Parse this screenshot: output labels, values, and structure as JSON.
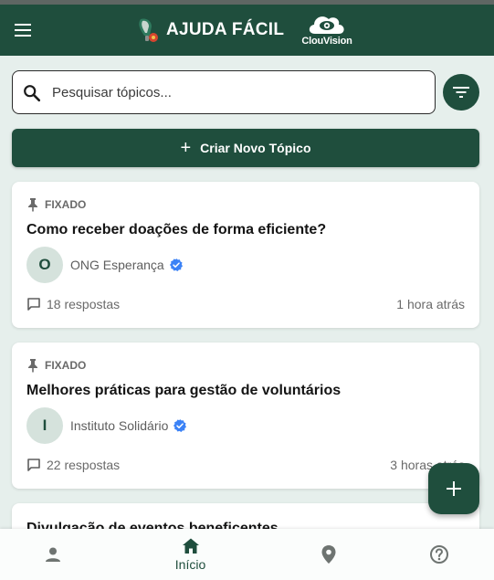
{
  "app": {
    "title": "AJUDA FÁCIL",
    "partner_logo_text": "ClouVision"
  },
  "colors": {
    "primary": "#1f4e3d",
    "background": "#e6efec",
    "verified": "#3b82f6"
  },
  "search": {
    "placeholder": "Pesquisar tópicos..."
  },
  "actions": {
    "new_topic_label": "Criar Novo Tópico"
  },
  "topics": [
    {
      "pinned_label": "FIXADO",
      "title": "Como receber doações de forma eficiente?",
      "author_initial": "O",
      "author": "ONG Esperança",
      "replies": "18 respostas",
      "time": "1 hora atrás"
    },
    {
      "pinned_label": "FIXADO",
      "title": "Melhores práticas para gestão de voluntários",
      "author_initial": "I",
      "author": "Instituto Solidário",
      "replies": "22 respostas",
      "time": "3 horas atrás"
    },
    {
      "title": "Divulgação de eventos beneficentes"
    }
  ],
  "bottom_nav": {
    "items": [
      {
        "icon": "person-icon",
        "label": ""
      },
      {
        "icon": "home-icon",
        "label": "Início"
      },
      {
        "icon": "location-pin-icon",
        "label": ""
      },
      {
        "icon": "help-icon",
        "label": ""
      }
    ]
  }
}
